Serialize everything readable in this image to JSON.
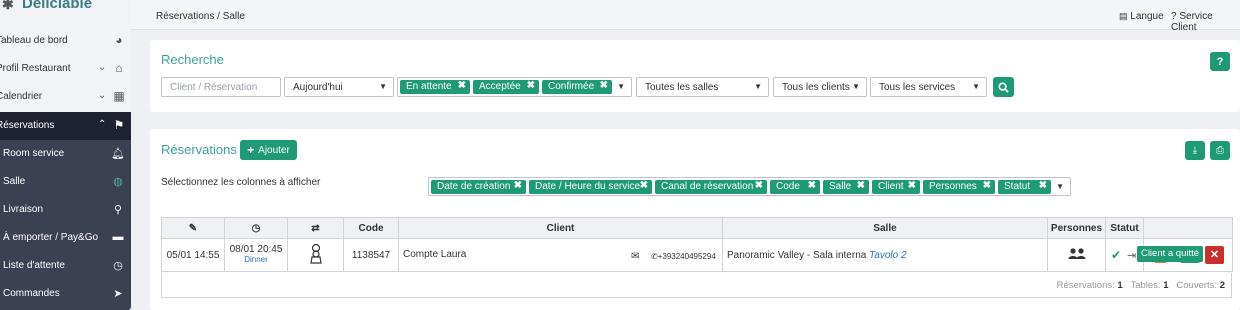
{
  "brand": {
    "name": "Deliciable"
  },
  "sidebar": {
    "items": [
      {
        "label": "Tableau de bord",
        "icon": "dashboard-icon"
      },
      {
        "label": "Profil Restaurant",
        "icon": "home-icon"
      },
      {
        "label": "Calendrier",
        "icon": "calendar-icon"
      },
      {
        "label": "Réservations",
        "icon": "flag-icon"
      }
    ],
    "submenu": [
      {
        "label": "Room service",
        "icon": "bell-icon"
      },
      {
        "label": "Salle",
        "icon": "salle-icon"
      },
      {
        "label": "Livraison",
        "icon": "bike-icon"
      },
      {
        "label": "À emporter / Pay&Go",
        "icon": "car-icon"
      },
      {
        "label": "Liste d'attente",
        "icon": "clock-icon"
      },
      {
        "label": "Commandes",
        "icon": "send-icon"
      }
    ]
  },
  "topbar": {
    "breadcrumb": "Réservations / Salle",
    "language": "Langue",
    "help": "Service Client"
  },
  "search": {
    "title": "Recherche",
    "help_button": "?",
    "client_placeholder": "Client / Réservation",
    "date_value": "Aujourd'hui",
    "status_tags": [
      "En attente",
      "Acceptée",
      "Confirmée"
    ],
    "rooms_value": "Toutes les salles",
    "clients_value": "Tous les clients",
    "services_value": "Tous les services"
  },
  "reservations": {
    "title": "Réservations",
    "add_label": "Ajouter",
    "columns_label": "Sélectionnez les colonnes à afficher",
    "column_tags": [
      "Date de création",
      "Date / Heure du service",
      "Canal de réservation",
      "Code",
      "Salle",
      "Client",
      "Personnes",
      "Statut"
    ],
    "table": {
      "headers": {
        "code": "Code",
        "client": "Client",
        "salle": "Salle",
        "personnes": "Personnes",
        "statut": "Statut"
      },
      "row": {
        "created": "05/01 14:55",
        "service_datetime": "08/01 20:45",
        "service_name": "Dinner",
        "code": "1138547",
        "client_name": "Compte Laura",
        "phone": "+393240495294",
        "salle": "Panoramic Valley - Sala interna",
        "table": "Tavolo 2"
      },
      "tooltip": "Client a quitté"
    },
    "footer": {
      "reservations_label": "Réservations:",
      "reservations_value": "1",
      "tables_label": "Tables:",
      "tables_value": "1",
      "covers_label": "Couverts:",
      "covers_value": "2"
    }
  },
  "colors": {
    "accent": "#1f9a77",
    "title": "#3ea39a",
    "sidebar_dark": "#1f2230",
    "submenu": "#3b4150",
    "danger": "#c9302c",
    "link": "#2c6fb7"
  }
}
